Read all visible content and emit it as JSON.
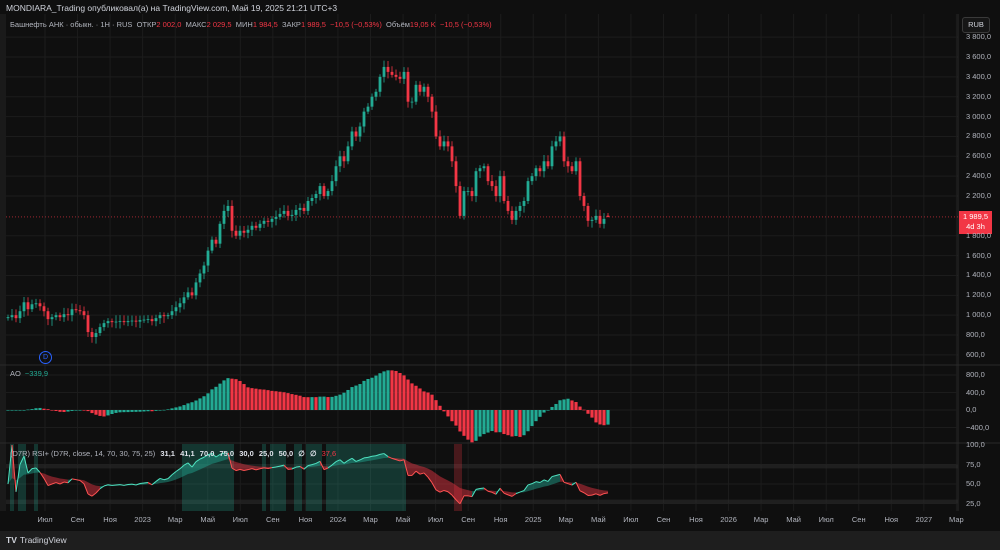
{
  "header": {
    "publisher_line": "MONDIARA_Trading опубликовал(а) на TradingView.com, Май 19, 2025 21:21 UTC+3"
  },
  "legend": {
    "symbol": "Башнефть АНК · обыкн. · 1Н · RUS",
    "open_label": "ОТКР",
    "open": "2 002,0",
    "high_label": "МАКС",
    "high": "2 029,5",
    "low_label": "МИН",
    "low": "1 984,5",
    "close_label": "ЗАКР",
    "close": "1 989,5",
    "change": "−10,5 (−0,53%)",
    "volume_label": "Объём",
    "volume": "19,05 K",
    "volume_change": "−10,5 (−0,53%)"
  },
  "currency": "RUB",
  "last_price": {
    "value": "1 989,5",
    "countdown": "4d 3h"
  },
  "dividend_marker": "D",
  "ao": {
    "label": "AO",
    "value": "−339,9"
  },
  "rsi": {
    "label": "(D7R) RSI+ (D7R, close, 14, 70, 30, 75, 25)",
    "values": [
      "31,1",
      "41,1",
      "70,0",
      "75,0",
      "30,0",
      "25,0",
      "50,0",
      "∅",
      "∅"
    ],
    "last": "37,6"
  },
  "footer": {
    "brand": "TradingView",
    "logo": "TV"
  },
  "colors": {
    "up": "#22ab94",
    "down": "#f23645",
    "background": "#0f0f0f",
    "grid": "#1c1c1c"
  },
  "chart_data": {
    "type": "candlestick",
    "price_axis": {
      "ticks": [
        "3 800,0",
        "3 600,0",
        "3 400,0",
        "3 200,0",
        "3 000,0",
        "2 800,0",
        "2 600,0",
        "2 400,0",
        "2 200,0",
        "1 800,0",
        "1 600,0",
        "1 400,0",
        "1 200,0",
        "1 000,0",
        "800,0",
        "600,0"
      ],
      "range": [
        600,
        3800
      ]
    },
    "ao_axis": {
      "ticks": [
        "800,0",
        "400,0",
        "0,0",
        "−400,0"
      ]
    },
    "rsi_axis": {
      "ticks": [
        "100,0",
        "75,0",
        "50,0",
        "25,0"
      ],
      "bands": [
        70,
        30
      ]
    },
    "time_labels": [
      "Июл",
      "Сен",
      "Ноя",
      "2023",
      "Мар",
      "Май",
      "Июл",
      "Сен",
      "Ноя",
      "2024",
      "Мар",
      "Май",
      "Июл",
      "Сен",
      "Ноя",
      "2025",
      "Мар",
      "Май",
      "Июл",
      "Сен",
      "Ноя",
      "2026",
      "Мар",
      "Май",
      "Июл",
      "Сен",
      "Ноя",
      "2027",
      "Мар"
    ],
    "weekly_closes": [
      980,
      1000,
      970,
      1040,
      1130,
      1060,
      1110,
      1120,
      1090,
      1040,
      960,
      980,
      1000,
      980,
      1010,
      1000,
      1060,
      1050,
      1040,
      1000,
      830,
      780,
      820,
      880,
      920,
      940,
      930,
      935,
      940,
      930,
      940,
      945,
      935,
      950,
      955,
      960,
      940,
      970,
      1000,
      990,
      1000,
      1040,
      1080,
      1120,
      1180,
      1230,
      1200,
      1330,
      1420,
      1500,
      1650,
      1760,
      1720,
      1920,
      2050,
      2100,
      1850,
      1800,
      1850,
      1830,
      1860,
      1900,
      1880,
      1920,
      1950,
      1940,
      1970,
      1990,
      2020,
      2050,
      2000,
      2010,
      2060,
      2080,
      2050,
      2150,
      2180,
      2220,
      2300,
      2200,
      2250,
      2350,
      2500,
      2600,
      2550,
      2700,
      2850,
      2800,
      2900,
      3050,
      3100,
      3200,
      3250,
      3400,
      3500,
      3450,
      3420,
      3400,
      3380,
      3450,
      3150,
      3150,
      3320,
      3250,
      3300,
      3200,
      3050,
      2800,
      2700,
      2750,
      2700,
      2550,
      2300,
      2000,
      2250,
      2250,
      2200,
      2450,
      2480,
      2500,
      2350,
      2300,
      2200,
      2400,
      2150,
      2050,
      1960,
      2050,
      2100,
      2150,
      2350,
      2400,
      2480,
      2450,
      2550,
      2500,
      2700,
      2750,
      2800,
      2550,
      2500,
      2450,
      2550,
      2200,
      2100,
      1950,
      1960,
      2000,
      1920,
      1970,
      1989.5
    ],
    "last_candle": {
      "open": 2002.0,
      "high": 2029.5,
      "low": 1984.5,
      "close": 1989.5
    }
  }
}
